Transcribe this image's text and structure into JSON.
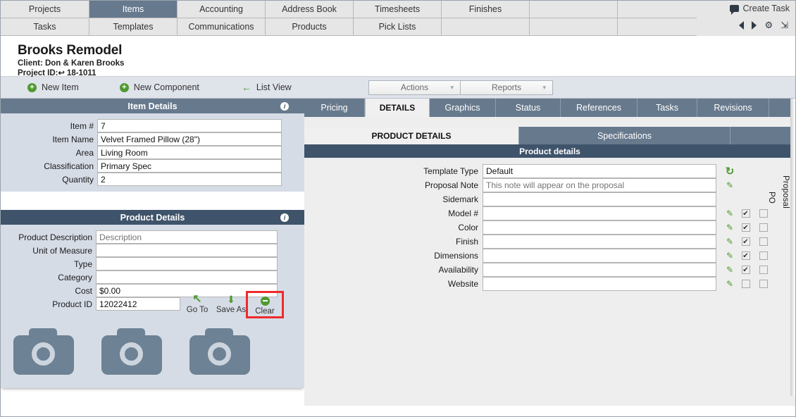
{
  "nav": {
    "row1": [
      "Projects",
      "Items",
      "Accounting",
      "Address Book",
      "Timesheets",
      "Finishes",
      ""
    ],
    "row2": [
      "Tasks",
      "Templates",
      "Communications",
      "Products",
      "Pick Lists",
      "",
      ""
    ],
    "active_tab": "Items",
    "create_task_label": "Create Task",
    "icons": [
      "comment-icon",
      "prev-icon",
      "next-icon",
      "gear-icon",
      "expand-icon"
    ]
  },
  "project": {
    "title": "Brooks Remodel",
    "client_line": "Client: Don & Karen Brooks",
    "project_id_label": "Project ID:",
    "project_id_value": "18-1011"
  },
  "toolbar": {
    "new_item": "New Item",
    "new_component": "New Component",
    "list_view": "List View",
    "actions": "Actions",
    "reports": "Reports"
  },
  "item_details": {
    "header": "Item Details",
    "fields": [
      {
        "label": "Item #",
        "value": "7",
        "placeholder": ""
      },
      {
        "label": "Item Name",
        "value": "Velvet Framed Pillow (28\")",
        "placeholder": ""
      },
      {
        "label": "Area",
        "value": "Living Room",
        "placeholder": ""
      },
      {
        "label": "Classification",
        "value": "Primary Spec",
        "placeholder": ""
      },
      {
        "label": "Quantity",
        "value": "2",
        "placeholder": ""
      }
    ]
  },
  "product_details_left": {
    "header": "Product Details",
    "fields": [
      {
        "label": "Product Description",
        "value": "",
        "placeholder": "Description"
      },
      {
        "label": "Unit of Measure",
        "value": "",
        "placeholder": ""
      },
      {
        "label": "Type",
        "value": "",
        "placeholder": ""
      },
      {
        "label": "Category",
        "value": "",
        "placeholder": ""
      },
      {
        "label": "Cost",
        "value": "$0.00",
        "placeholder": ""
      },
      {
        "label": "Product ID",
        "value": "12022412",
        "placeholder": ""
      }
    ],
    "actions": [
      {
        "label": "Go To",
        "icon": "arrow-up-left-icon",
        "highlighted": false
      },
      {
        "label": "Save As",
        "icon": "save-download-icon",
        "highlighted": false
      },
      {
        "label": "Clear",
        "icon": "minus-circle-icon",
        "highlighted": true
      }
    ],
    "photo_placeholders": [
      "camera-icon",
      "camera-icon",
      "camera-icon"
    ]
  },
  "right_panel": {
    "tabs": [
      "Pricing",
      "DETAILS",
      "Graphics",
      "Status",
      "References",
      "Tasks",
      "Revisions"
    ],
    "active_tab": "DETAILS",
    "subtabs": [
      "PRODUCT DETAILS",
      "Specifications"
    ],
    "active_subtab": "PRODUCT DETAILS",
    "section_header": "Product details",
    "column_headers": {
      "po": "PO",
      "proposal": "Proposal"
    },
    "rows": [
      {
        "label": "Template Type",
        "value": "Default",
        "placeholder": "",
        "icon": "refresh-icon",
        "po": null,
        "proposal": null
      },
      {
        "label": "Proposal Note",
        "value": "",
        "placeholder": "This note will appear on the proposal",
        "icon": "pencil-icon",
        "po": null,
        "proposal": null
      },
      {
        "label": "Sidemark",
        "value": "",
        "placeholder": "",
        "icon": "",
        "po": null,
        "proposal": null
      },
      {
        "label": "Model #",
        "value": "",
        "placeholder": "",
        "icon": "pencil-icon",
        "po": true,
        "proposal": false
      },
      {
        "label": "Color",
        "value": "",
        "placeholder": "",
        "icon": "pencil-icon",
        "po": true,
        "proposal": false
      },
      {
        "label": "Finish",
        "value": "",
        "placeholder": "",
        "icon": "pencil-icon",
        "po": true,
        "proposal": false
      },
      {
        "label": "Dimensions",
        "value": "",
        "placeholder": "",
        "icon": "pencil-icon",
        "po": true,
        "proposal": false
      },
      {
        "label": "Availability",
        "value": "",
        "placeholder": "",
        "icon": "pencil-icon",
        "po": true,
        "proposal": false
      },
      {
        "label": "Website",
        "value": "",
        "placeholder": "",
        "icon": "pencil-icon",
        "po": false,
        "proposal": false
      }
    ]
  },
  "colors": {
    "nav_active": "#67798d",
    "panel_header_slate": "#67798d",
    "panel_header_navy": "#3f546b",
    "panel_bg": "#d6dce6",
    "accent_green": "#4e9a2f",
    "highlight_red": "#ee2b2b",
    "camera_gray": "#6d8294"
  }
}
